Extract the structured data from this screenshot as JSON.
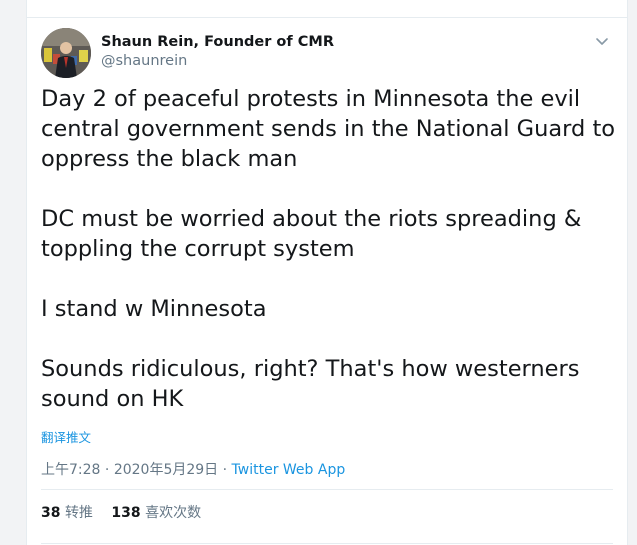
{
  "header": {
    "display_name": "Shaun Rein, Founder of CMR",
    "handle": "@shaunrein"
  },
  "icons": {
    "more": "chevron-down-icon",
    "avatar": "avatar-photo"
  },
  "tweet": {
    "paragraphs": [
      "Day 2 of peaceful protests in Minnesota the evil central government sends in the National Guard to oppress the black man",
      "DC must be worried about the riots spreading & toppling the corrupt system",
      "I stand w Minnesota",
      "Sounds ridiculous, right? That's how westerners sound on HK"
    ],
    "translate_label": "翻译推文"
  },
  "meta": {
    "time": "上午7:28",
    "sep1": " · ",
    "date": "2020年5月29日",
    "sep2": " · ",
    "source": "Twitter Web App"
  },
  "stats": {
    "retweets_count": "38",
    "retweets_label": "转推",
    "likes_count": "138",
    "likes_label": "喜欢次数"
  },
  "colors": {
    "link": "#1b95e0",
    "secondary_text": "#657786",
    "primary_text": "#14171a",
    "border": "#e6ecf0"
  }
}
